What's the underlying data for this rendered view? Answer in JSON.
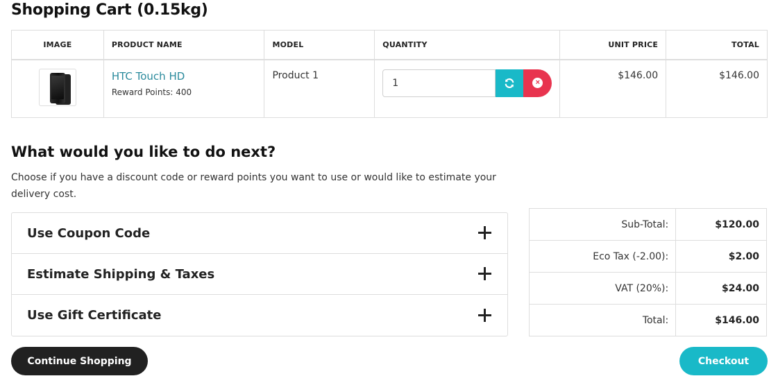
{
  "cart": {
    "title": "Shopping Cart",
    "weight": "(0.15kg)",
    "columns": {
      "image": "IMAGE",
      "product_name": "PRODUCT NAME",
      "model": "MODEL",
      "quantity": "QUANTITY",
      "unit_price": "UNIT PRICE",
      "total": "TOTAL"
    },
    "items": [
      {
        "image_icon": "phone-product-image",
        "name": "HTC Touch HD",
        "reward_points": "Reward Points: 400",
        "model": "Product 1",
        "quantity": "1",
        "unit_price": "$146.00",
        "total": "$146.00"
      }
    ],
    "update_icon": "refresh-icon",
    "remove_icon": "remove-icon"
  },
  "next": {
    "title": "What would you like to do next?",
    "description": "Choose if you have a discount code or reward points you want to use or would like to estimate your delivery cost.",
    "sections": [
      {
        "label": "Use Coupon Code",
        "icon": "plus-icon"
      },
      {
        "label": "Estimate Shipping & Taxes",
        "icon": "plus-icon"
      },
      {
        "label": "Use Gift Certificate",
        "icon": "plus-icon"
      }
    ]
  },
  "totals": [
    {
      "label": "Sub-Total:",
      "value": "$120.00"
    },
    {
      "label": "Eco Tax (-2.00):",
      "value": "$2.00"
    },
    {
      "label": "VAT (20%):",
      "value": "$24.00"
    },
    {
      "label": "Total:",
      "value": "$146.00"
    }
  ],
  "actions": {
    "continue_label": "Continue Shopping",
    "checkout_label": "Checkout"
  },
  "colors": {
    "accent": "#19b9c8",
    "danger": "#e8344f",
    "link": "#2a8a9c",
    "dark_button": "#212121"
  }
}
